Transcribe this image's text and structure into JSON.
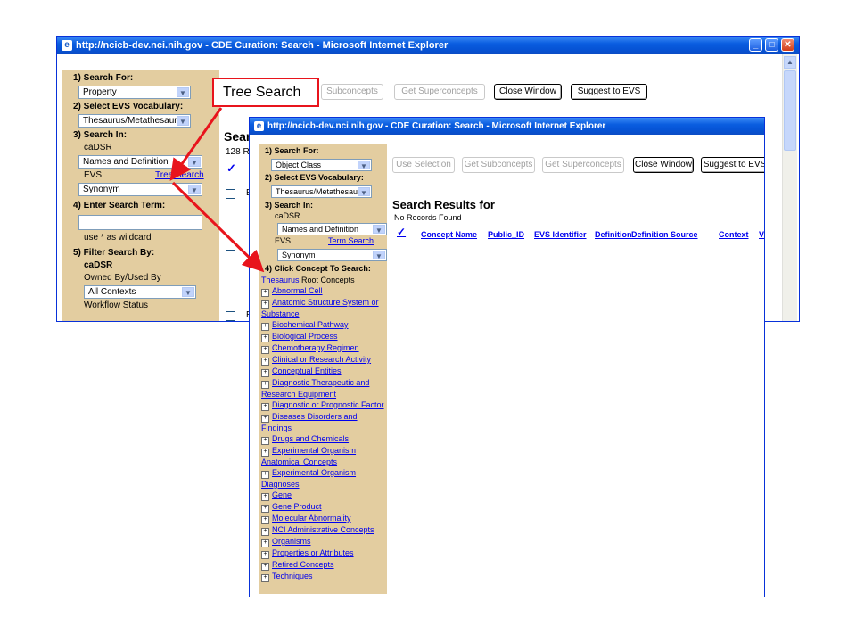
{
  "window1": {
    "title": "http://ncicb-dev.nci.nih.gov - CDE Curation: Search - Microsoft Internet Explorer",
    "panel": {
      "search_for_label": "1) Search For:",
      "search_for_value": "Property",
      "vocab_label": "2) Select EVS Vocabulary:",
      "vocab_value": "Thesaurus/Metathesauru",
      "search_in_label": "3) Search In:",
      "cadsr_label": "caDSR",
      "search_in_value": "Names and Definition",
      "evs_label": "EVS",
      "tree_search_link": "Tree Search",
      "evs_value": "Synonym",
      "term_label": "4) Enter Search Term:",
      "wildcard_hint": "use * as wildcard",
      "filter_label": "5) Filter Search By:",
      "filter_cadsr": "caDSR",
      "owned_label": "Owned By/Used By",
      "owned_value": "All Contexts",
      "workflow_label": "Workflow Status"
    },
    "toolbar": {
      "subconcepts": "Subconcepts",
      "superconcepts": "Get Superconcepts",
      "close": "Close Window",
      "suggest": "Suggest to EVS"
    },
    "results_title": "Sear",
    "results_count": "128 R",
    "row_letters": [
      "E",
      "E"
    ]
  },
  "callout": {
    "text": "Tree Search"
  },
  "window2": {
    "title": "http://ncicb-dev.nci.nih.gov - CDE Curation: Search - Microsoft Internet Explorer",
    "panel": {
      "search_for_label": "1) Search For:",
      "search_for_value": "Object Class",
      "vocab_label": "2) Select EVS Vocabulary:",
      "vocab_value": "Thesaurus/Metathesauru",
      "search_in_label": "3) Search In:",
      "cadsr_label": "caDSR",
      "search_in_value": "Names and Definition",
      "evs_label": "EVS",
      "term_search_link": "Term Search",
      "evs_value": "Synonym",
      "click_concept_label": "4) Click Concept To Search:",
      "thesaurus_link": "Thesaurus",
      "root_concepts_text": "Root Concepts",
      "tree_items": [
        "Abnormal Cell",
        "Anatomic Structure System or Substance",
        "Biochemical Pathway",
        "Biological Process",
        "Chemotherapy Regimen",
        "Clinical or Research Activity",
        "Conceptual Entities",
        "Diagnostic Therapeutic and Research Equipment",
        "Diagnostic or Prognostic Factor",
        "Diseases Disorders and Findings",
        "Drugs and Chemicals",
        "Experimental Organism Anatomical Concepts",
        "Experimental Organism Diagnoses",
        "Gene",
        "Gene Product",
        "Molecular Abnormality",
        "NCI Administrative Concepts",
        "Organisms",
        "Properties or Attributes",
        "Retired Concepts",
        "Techniques"
      ]
    },
    "toolbar": {
      "use_selection": "Use Selection",
      "get_subconcepts": "Get Subconcepts",
      "get_superconcepts": "Get Superconcepts",
      "close": "Close Window",
      "suggest": "Suggest to EVS"
    },
    "results_title": "Search Results for",
    "no_records": "No Records Found",
    "columns": [
      "Concept Name",
      "Public_ID",
      "EVS Identifier",
      "Definition",
      "Definition Source",
      "Context",
      "V"
    ]
  },
  "colors": {
    "panel_tan": "#e3cda0",
    "title_blue": "#0a5de0",
    "callout_red": "#e8141c"
  }
}
